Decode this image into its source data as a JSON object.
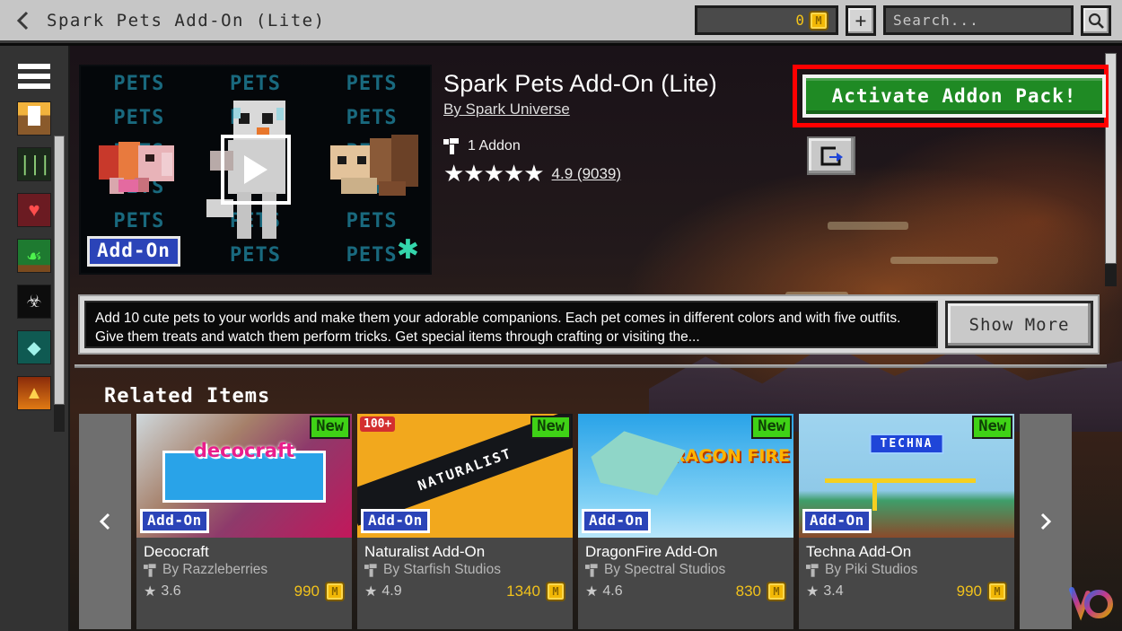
{
  "header": {
    "back_icon": "chevron-left-icon",
    "title": "Spark Pets Add-On (Lite)",
    "coin_amount": "0",
    "coin_icon": "minecoin-icon",
    "add_label": "+",
    "search_placeholder": "Search...",
    "search_value": "",
    "search_icon": "magnifier-icon"
  },
  "sidebar": {
    "menu_icon": "hamburger-menu-icon",
    "items": [
      {
        "name": "banner-icon",
        "glyph": "▒"
      },
      {
        "name": "bookshelf-icon",
        "glyph": "‖"
      },
      {
        "name": "heart-icon",
        "glyph": "♥"
      },
      {
        "name": "sapling-icon",
        "glyph": "⑂"
      },
      {
        "name": "mob-skull-icon",
        "glyph": "☠"
      },
      {
        "name": "diamond-icon",
        "glyph": "◆"
      },
      {
        "name": "fire-icon",
        "glyph": "▲"
      }
    ]
  },
  "hero": {
    "thumbnail": {
      "tiled_text": "PETS",
      "addon_badge": "Add-On",
      "play_icon": "play-button-icon",
      "asterisk_icon": "sparkle-asterisk-icon"
    },
    "title": "Spark Pets Add-On (Lite)",
    "author": "By Spark Universe",
    "addon_icon": "addon-pack-icon",
    "addon_count": "1 Addon",
    "stars": "★★★★★",
    "rating_text": "4.9 (9039)",
    "rating_value": "4.9",
    "rating_count": "9039",
    "activate_label": "Activate Addon Pack!",
    "share_icon": "share-export-icon",
    "highlight_color": "#ff0000",
    "activate_color": "#1f8a24"
  },
  "description": {
    "text": "Add 10 cute pets to your worlds and make them your adorable companions. Each pet comes in different colors and with five outfits. Give them treats and watch them perform tricks. Get special items through crafting or visiting the...",
    "show_more_label": "Show More"
  },
  "related": {
    "title": "Related Items",
    "prev_icon": "chevron-left-icon",
    "next_icon": "chevron-right-icon",
    "cards": [
      {
        "title": "Decocraft",
        "author": "By Razzleberries",
        "rating": "3.6",
        "price": "990",
        "badge_new": "New",
        "badge_addon": "Add-On",
        "art_text": "decocraft"
      },
      {
        "title": "Naturalist Add-On",
        "author": "By Starfish Studios",
        "rating": "4.9",
        "price": "1340",
        "badge_new": "New",
        "badge_addon": "Add-On",
        "art_text": "NATURALIST",
        "art_corner": "100+"
      },
      {
        "title": "DragonFire Add-On",
        "author": "By Spectral Studios",
        "rating": "4.6",
        "price": "830",
        "badge_new": "New",
        "badge_addon": "Add-On",
        "art_text": "DRAGON FIRE"
      },
      {
        "title": "Techna Add-On",
        "author": "By Piki Studios",
        "rating": "3.4",
        "price": "990",
        "badge_new": "New",
        "badge_addon": "Add-On",
        "art_text": "TECHNA"
      }
    ]
  },
  "watermark": {
    "name": "brand-watermark"
  }
}
